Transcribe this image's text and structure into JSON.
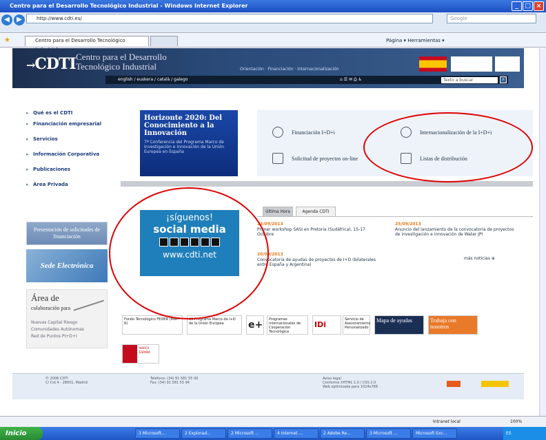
{
  "window": {
    "title": "Centro para el Desarrollo Tecnológico Industrial - Windows Internet Explorer"
  },
  "browser": {
    "url": "http://www.cdti.es/",
    "search_placeholder": "Google",
    "tab_title": "Centro para el Desarrollo Tecnológico Industrial",
    "tools": "Página ▾   Herramientas ▾"
  },
  "header": {
    "logo": "CDTI",
    "subtitle_line1": "Centro para el Desarrollo",
    "subtitle_line2": "Tecnológico Industrial",
    "slogan": "Orientación · Financiación · Internacionalización",
    "languages": "english / euskera / català / galego",
    "search_placeholder": "Texto a buscar"
  },
  "nav": {
    "items": [
      "Qué es el CDTI",
      "Financiación empresarial",
      "Servicios",
      "Información Corporativa",
      "Publicaciones",
      "Área Privada"
    ]
  },
  "left_boxes": {
    "presentacion": "Presentación de solicitudes de financiación",
    "sede": "Sede Electrónica",
    "area_title": "Área de",
    "area_sub": "colaboración para",
    "area_links": [
      "Nuevas Capital Riesgo",
      "Comunidades Autónomas",
      "Red de Puntos PI+D+I"
    ]
  },
  "banner": {
    "title": "Horizonte 2020: Del Conocimiento a la Innovación",
    "sub": "7ª Conferencia del Programa Marco de Investigación e Innovación de la Unión Europea en España"
  },
  "financing": {
    "items": [
      "Financiación I+D+i",
      "Internacionalización de la I+D+i",
      "Solicitud de proyectos on-line",
      "Listas de distribución"
    ]
  },
  "social": {
    "line1": "¡síguenos!",
    "line2": "social media",
    "url": "www.cdti.net"
  },
  "news": {
    "tabs": [
      "Última Hora",
      "Agenda CDTI"
    ],
    "items": [
      {
        "date": "23/09/2013",
        "text": "Primer workshop SASI en Pretoria (Sudáfrica), 15-17 Octubre"
      },
      {
        "date": "25/09/2013",
        "text": "Anuncio del lanzamiento de la convocatoria de proyectos de investigación e innovación de Water JPI"
      },
      {
        "date": "20/09/2013",
        "text": "Convocatoria de ayudas de proyectos de I+D (bilaterales entre España y Argentina)"
      }
    ],
    "more": "más noticias"
  },
  "logos": [
    "Fondo Tecnológico FEDER (MAP-R)",
    "VII Programa Marco de I+D de la Unión Europea",
    "e+",
    "Programas Internacionales de Cooperación Tecnológica",
    "IDi",
    "Servicio de Asesoramiento Personalizado",
    "Mapa de ayudas",
    "Trabaja con nosotros",
    "MARCA ESPAÑA"
  ],
  "footer": {
    "col1": [
      "© 2006 CDTI",
      "C/ Cid 4 - 28001, Madrid"
    ],
    "col2": [
      "Teléfono: (34) 91 581 55 00",
      "Fax: (34) 91 581 55 94"
    ],
    "col3": [
      "Aviso legal",
      "Conforme XHTML 1.0 / CSS 2.0",
      "Web optimizada para 1024x768"
    ]
  },
  "status": {
    "zone": "Intranet local",
    "zoom": "100%"
  },
  "taskbar": {
    "start": "Inicio",
    "tasks": [
      "3 Microsoft...",
      "2 Explorad...",
      "2 Microsoft ...",
      "4 Internet ...",
      "2 Adobe Re...",
      "3 Microsoft ...",
      "Microsoft Exc..."
    ],
    "tray": "ES"
  }
}
